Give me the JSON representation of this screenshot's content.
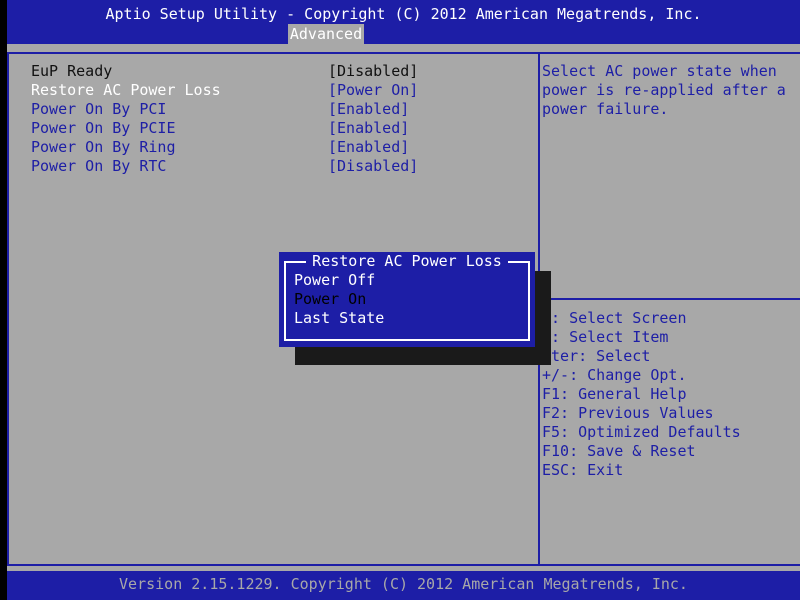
{
  "header": {
    "title": "Aptio Setup Utility - Copyright (C) 2012 American Megatrends, Inc.",
    "active_tab": "Advanced"
  },
  "settings": [
    {
      "label": "EuP Ready",
      "value": "[Disabled]",
      "selectable": false
    },
    {
      "label": "Restore AC Power Loss",
      "value": "[Power On]",
      "selectable": true,
      "selected": true
    },
    {
      "label": "Power On By PCI",
      "value": "[Enabled]",
      "selectable": true
    },
    {
      "label": "Power On By PCIE",
      "value": "[Enabled]",
      "selectable": true
    },
    {
      "label": "Power On By Ring",
      "value": "[Enabled]",
      "selectable": true
    },
    {
      "label": "Power On By RTC",
      "value": "[Disabled]",
      "selectable": true
    }
  ],
  "help": {
    "lines": [
      "Select AC power state when",
      "power is re-applied after a",
      "power failure."
    ]
  },
  "keys": [
    "←: Select Screen",
    "↓: Select Item",
    "nter: Select",
    "+/-: Change Opt.",
    "F1: General Help",
    "F2: Previous Values",
    "F5: Optimized Defaults",
    "F10: Save & Reset",
    "ESC: Exit"
  ],
  "popup": {
    "title": "Restore AC Power Loss",
    "options": [
      "Power Off",
      "Power On",
      "Last State"
    ],
    "highlighted_index": 1
  },
  "footer": {
    "text": "Version 2.15.1229. Copyright (C) 2012 American Megatrends, Inc."
  },
  "colors": {
    "bios_blue": "#1d1ea6",
    "bios_gray": "#a8a8a8",
    "highlight_text": "#ffffff"
  }
}
